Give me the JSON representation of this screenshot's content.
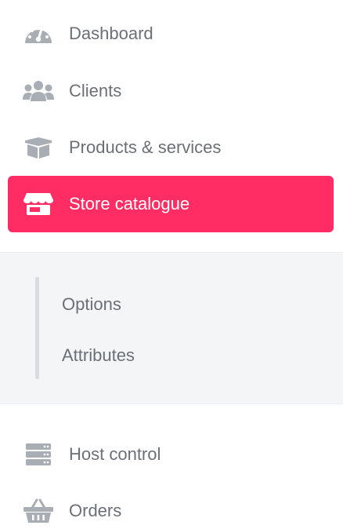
{
  "menu": {
    "items": [
      {
        "label": "Dashboard",
        "icon": "dashboard-gauge-icon"
      },
      {
        "label": "Clients",
        "icon": "users-icon"
      },
      {
        "label": "Products & services",
        "icon": "box-icon"
      },
      {
        "label": "Store catalogue",
        "icon": "store-icon",
        "active": true
      },
      {
        "label": "Host control",
        "icon": "server-icon"
      },
      {
        "label": "Orders",
        "icon": "basket-icon"
      }
    ],
    "submenu": [
      {
        "label": "Options"
      },
      {
        "label": "Attributes"
      }
    ]
  },
  "colors": {
    "accent": "#ff2d63",
    "text": "#6b6f76",
    "icon": "#a9adb4",
    "submenu_bg": "#f4f5f7"
  }
}
